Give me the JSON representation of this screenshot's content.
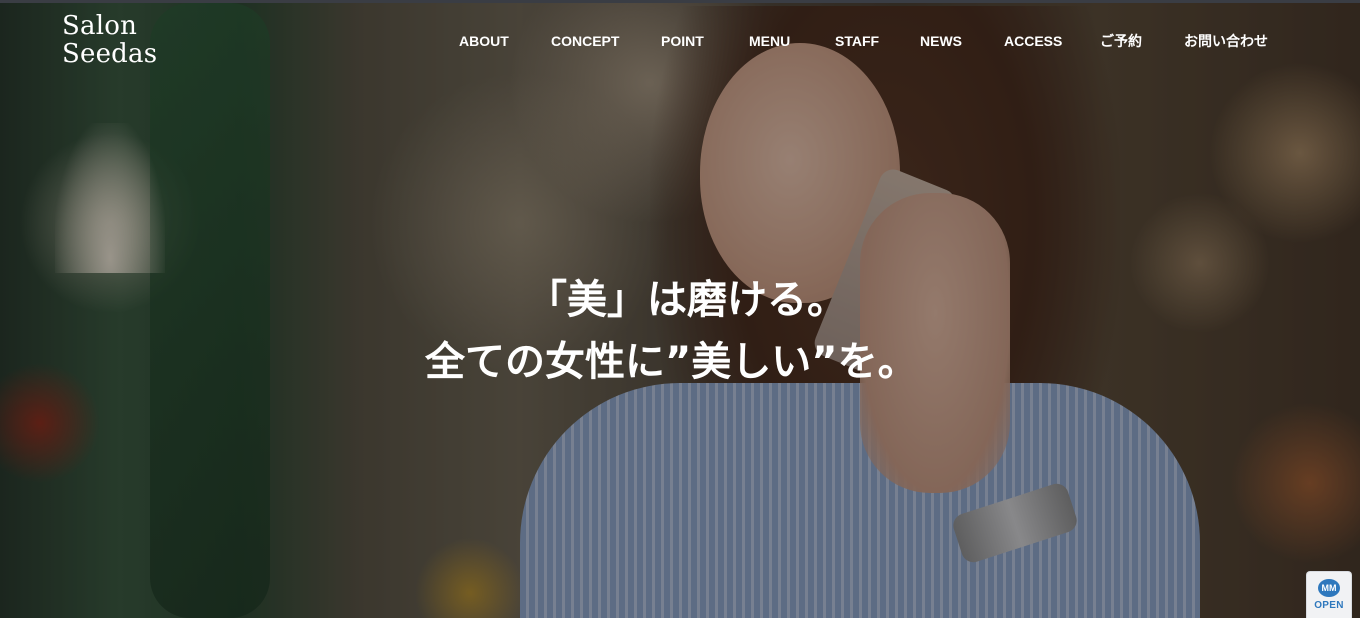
{
  "brand": {
    "line1": "Salon",
    "line2": "Seedas"
  },
  "nav": [
    {
      "label": "ABOUT"
    },
    {
      "label": "CONCEPT"
    },
    {
      "label": "POINT"
    },
    {
      "label": "MENU"
    },
    {
      "label": "STAFF"
    },
    {
      "label": "NEWS"
    },
    {
      "label": "ACCESS"
    },
    {
      "label": "ご予約"
    },
    {
      "label": "お問い合わせ"
    }
  ],
  "hero": {
    "line1": "「美」は磨ける。",
    "line2": "全ての女性に”美しい”を。"
  },
  "badge": {
    "icon": "MM",
    "label": "OPEN"
  }
}
